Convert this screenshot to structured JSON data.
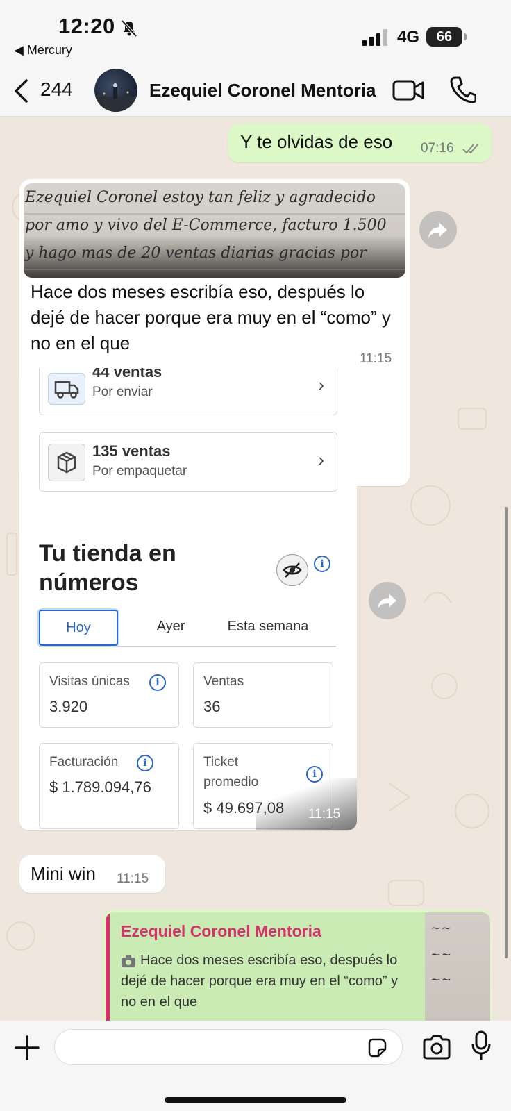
{
  "status_bar": {
    "time": "12:20",
    "back_app": "◀ Mercury",
    "network": "4G",
    "battery": "66"
  },
  "header": {
    "back_count": "244",
    "contact_name": "Ezequiel Coronel Mentoria"
  },
  "messages": {
    "out1": {
      "text": "Y te olvidas de eso",
      "time": "07:16"
    },
    "in_image": {
      "handwriting": [
        "Ezequiel Coronel estoy tan feliz y agradecido",
        "por amo y vivo del E-Commerce, facturo 1.500",
        "y hago mas de 20 ventas diarias gracias por"
      ],
      "caption": "Hace dos meses escribía eso, después lo dejé de hacer porque era muy en el “como” y no en el que",
      "time": "11:15"
    },
    "in_screenshot": {
      "row1_title": "44 ventas",
      "row1_sub": "Por enviar",
      "row2_title": "135 ventas",
      "row2_sub": "Por empaquetar",
      "section_title_1": "Tu tienda en",
      "section_title_2": "números",
      "tabs": [
        "Hoy",
        "Ayer",
        "Esta semana"
      ],
      "m1_label": "Visitas únicas",
      "m1_value": "3.920",
      "m2_label": "Ventas",
      "m2_value": "36",
      "m3_label": "Facturación",
      "m3_value": "$ 1.789.094,76",
      "m4_label_1": "Ticket",
      "m4_label_2": "promedio",
      "m4_value": "$ 49.697,08",
      "time": "11:15"
    },
    "in_mini": {
      "text": "Mini win",
      "time": "11:15"
    },
    "out_reply": {
      "quoted_name": "Ezequiel Coronel Mentoria",
      "quoted_text": "Hace dos meses escribía eso, después lo dejé de hacer porque era muy en el “como” y no en el que"
    }
  },
  "colors": {
    "outgoing_bubble": "#dcf8c6",
    "incoming_bubble": "#ffffff",
    "chat_bg": "#efe7de",
    "quote_accent": "#d6336c",
    "link_blue": "#2968c8"
  },
  "icons": [
    "back-chevron-icon",
    "video-call-icon",
    "phone-icon",
    "forward-icon",
    "double-check-icon",
    "truck-icon",
    "box-icon",
    "chevron-right-icon",
    "eye-off-icon",
    "info-icon",
    "plus-icon",
    "sticker-icon",
    "camera-icon",
    "mic-icon",
    "camera-small-icon"
  ]
}
